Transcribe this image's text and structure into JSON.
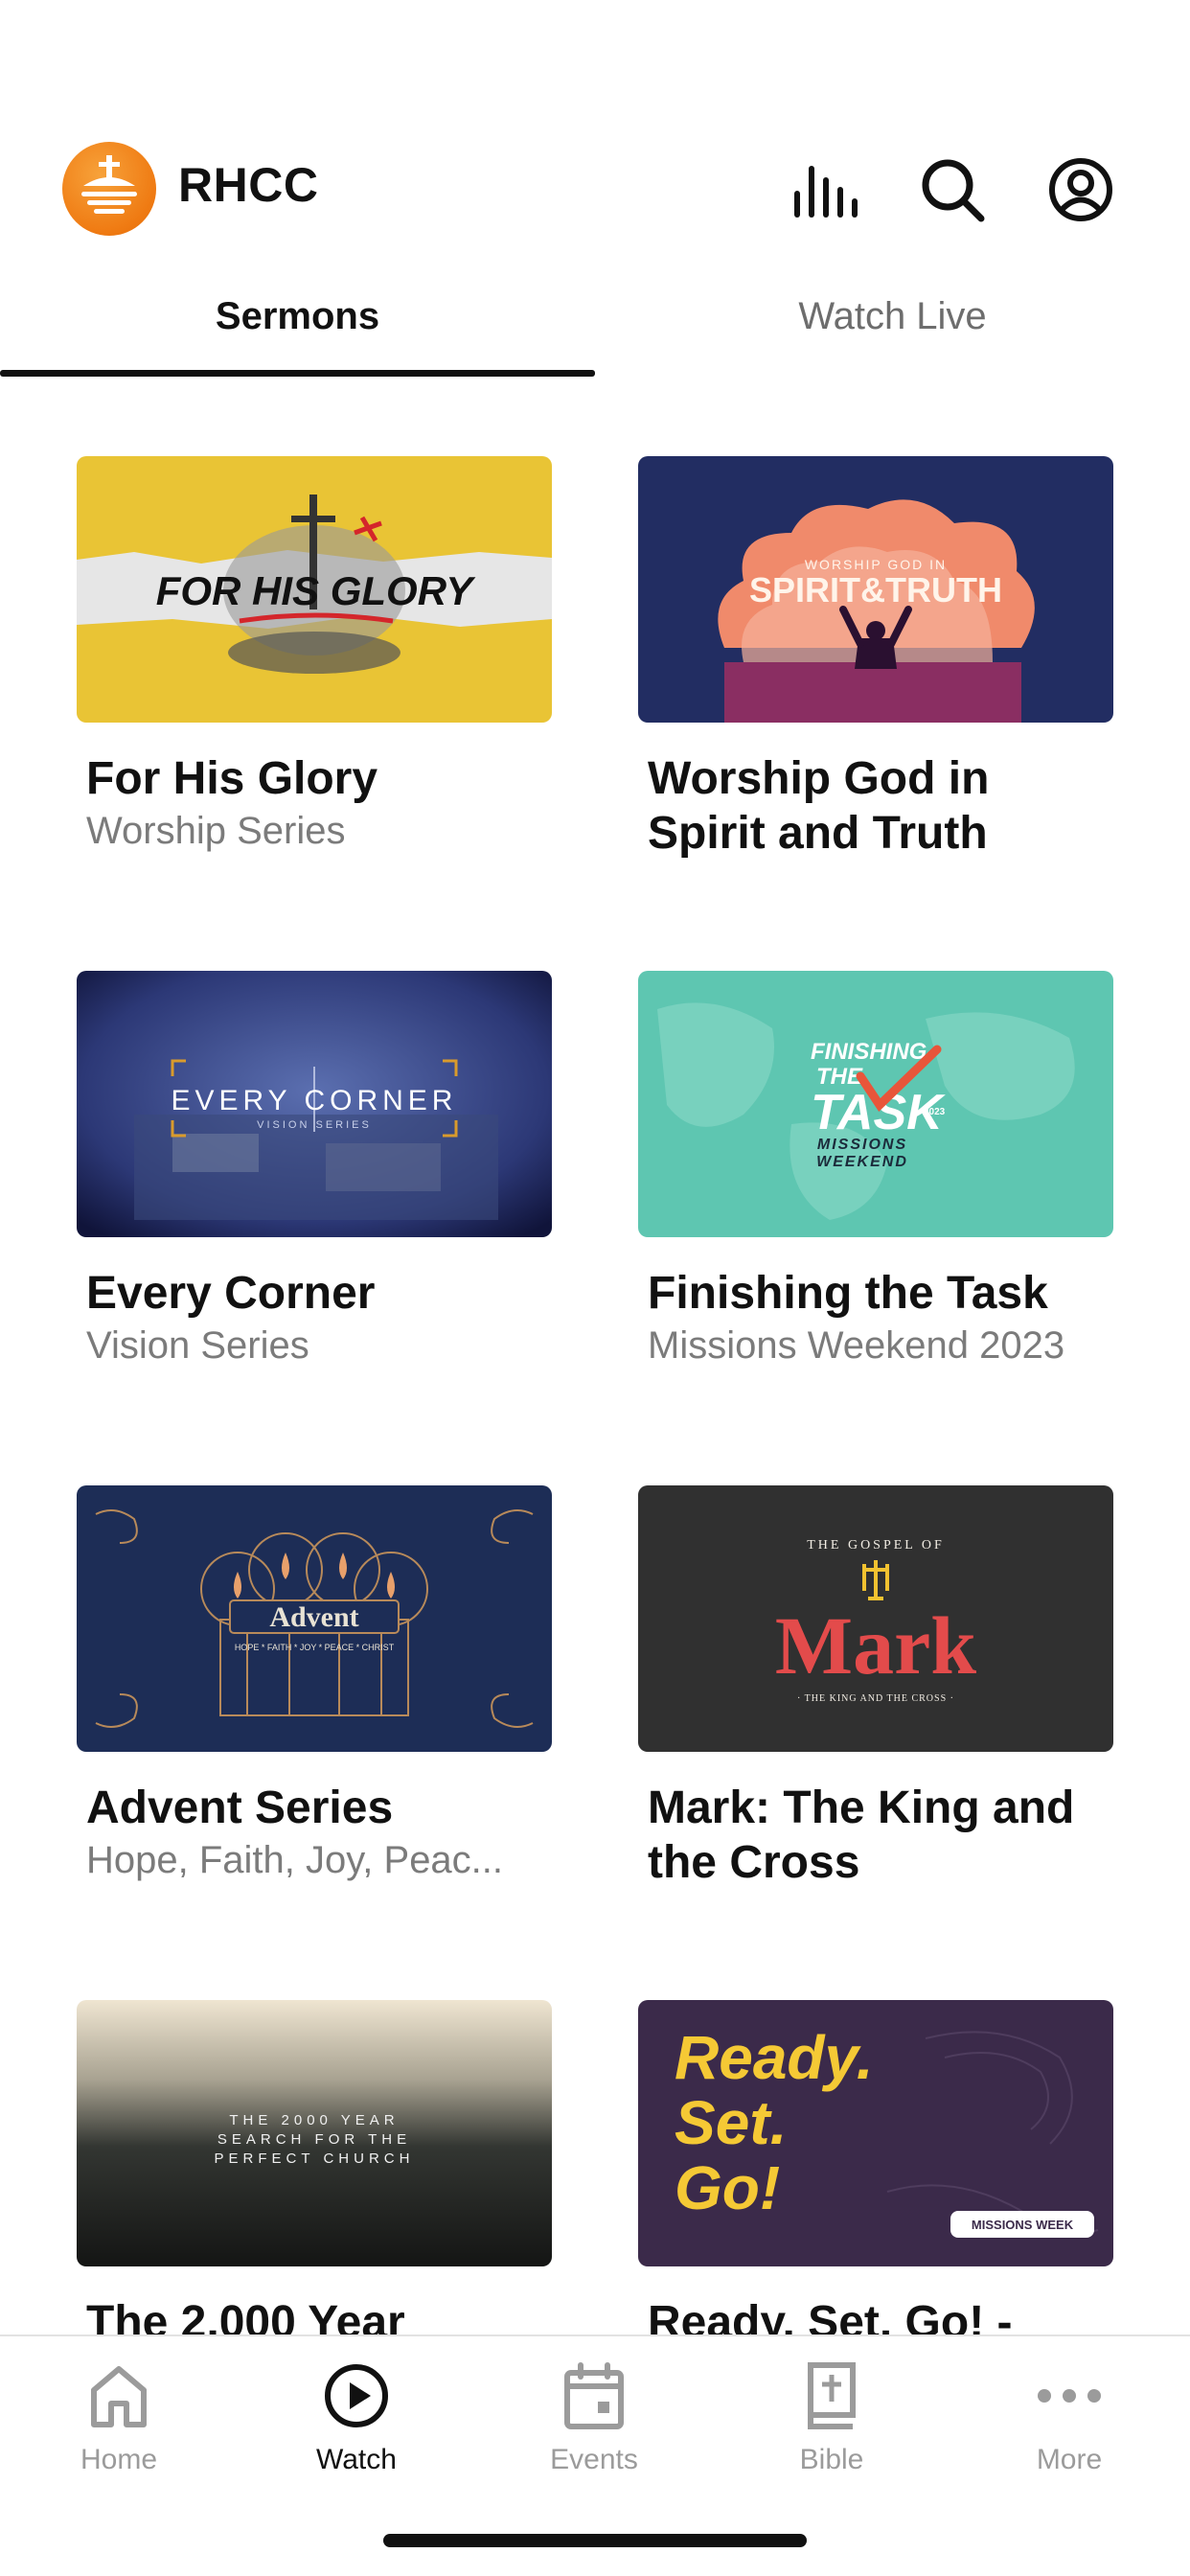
{
  "header": {
    "app_name": "RHCC",
    "icons": [
      "logo-icon",
      "audio-bars-icon",
      "search-icon",
      "profile-icon"
    ]
  },
  "tabs": [
    {
      "label": "Sermons",
      "active": true
    },
    {
      "label": "Watch Live",
      "active": false
    }
  ],
  "series": [
    {
      "title": "For His Glory",
      "subtitle": "Worship Series",
      "art_text": "FOR HIS GLORY"
    },
    {
      "title": "Worship God in Spirit and Truth",
      "subtitle": "",
      "art_text_top": "WORSHIP GOD IN",
      "art_text": "SPIRIT&TRUTH"
    },
    {
      "title": "Every Corner",
      "subtitle": "Vision Series",
      "art_text": "EVERY CORNER",
      "art_sub": "VISION SERIES"
    },
    {
      "title": "Finishing the Task",
      "subtitle": "Missions Weekend 2023",
      "art_text_top": "FINISHING",
      "art_text_mid": "THE",
      "art_text": "TASK",
      "art_year": "2023",
      "art_sub": "MISSIONS",
      "art_sub2": "WEEKEND"
    },
    {
      "title": "Advent Series",
      "subtitle": "Hope, Faith, Joy, Peac...",
      "art_text": "Advent",
      "art_sub": "HOPE * FAITH * JOY * PEACE * CHRIST"
    },
    {
      "title": "Mark: The King and the Cross",
      "subtitle": "",
      "art_text_top": "THE GOSPEL OF",
      "art_text": "Mark",
      "art_sub": "· THE KING AND THE CROSS ·"
    },
    {
      "title": "The 2,000 Year",
      "subtitle": "",
      "art_line1": "THE 2000 YEAR",
      "art_line2": "SEARCH FOR THE",
      "art_line3": "PERFECT CHURCH"
    },
    {
      "title": "Ready. Set. Go! -",
      "subtitle": "",
      "art_line1": "Ready.",
      "art_line2": "Set.",
      "art_line3": "Go!",
      "art_badge": "MISSIONS WEEK"
    }
  ],
  "bottom_nav": [
    {
      "label": "Home",
      "icon": "home-icon",
      "active": false
    },
    {
      "label": "Watch",
      "icon": "play-circle-icon",
      "active": true
    },
    {
      "label": "Events",
      "icon": "calendar-icon",
      "active": false
    },
    {
      "label": "Bible",
      "icon": "bible-icon",
      "active": false
    },
    {
      "label": "More",
      "icon": "more-dots-icon",
      "active": false
    }
  ],
  "colors": {
    "logo_orange": "#ef7a12",
    "text_primary": "#111111",
    "text_secondary": "#7b7b7b",
    "nav_inactive": "#9b9b9b"
  }
}
